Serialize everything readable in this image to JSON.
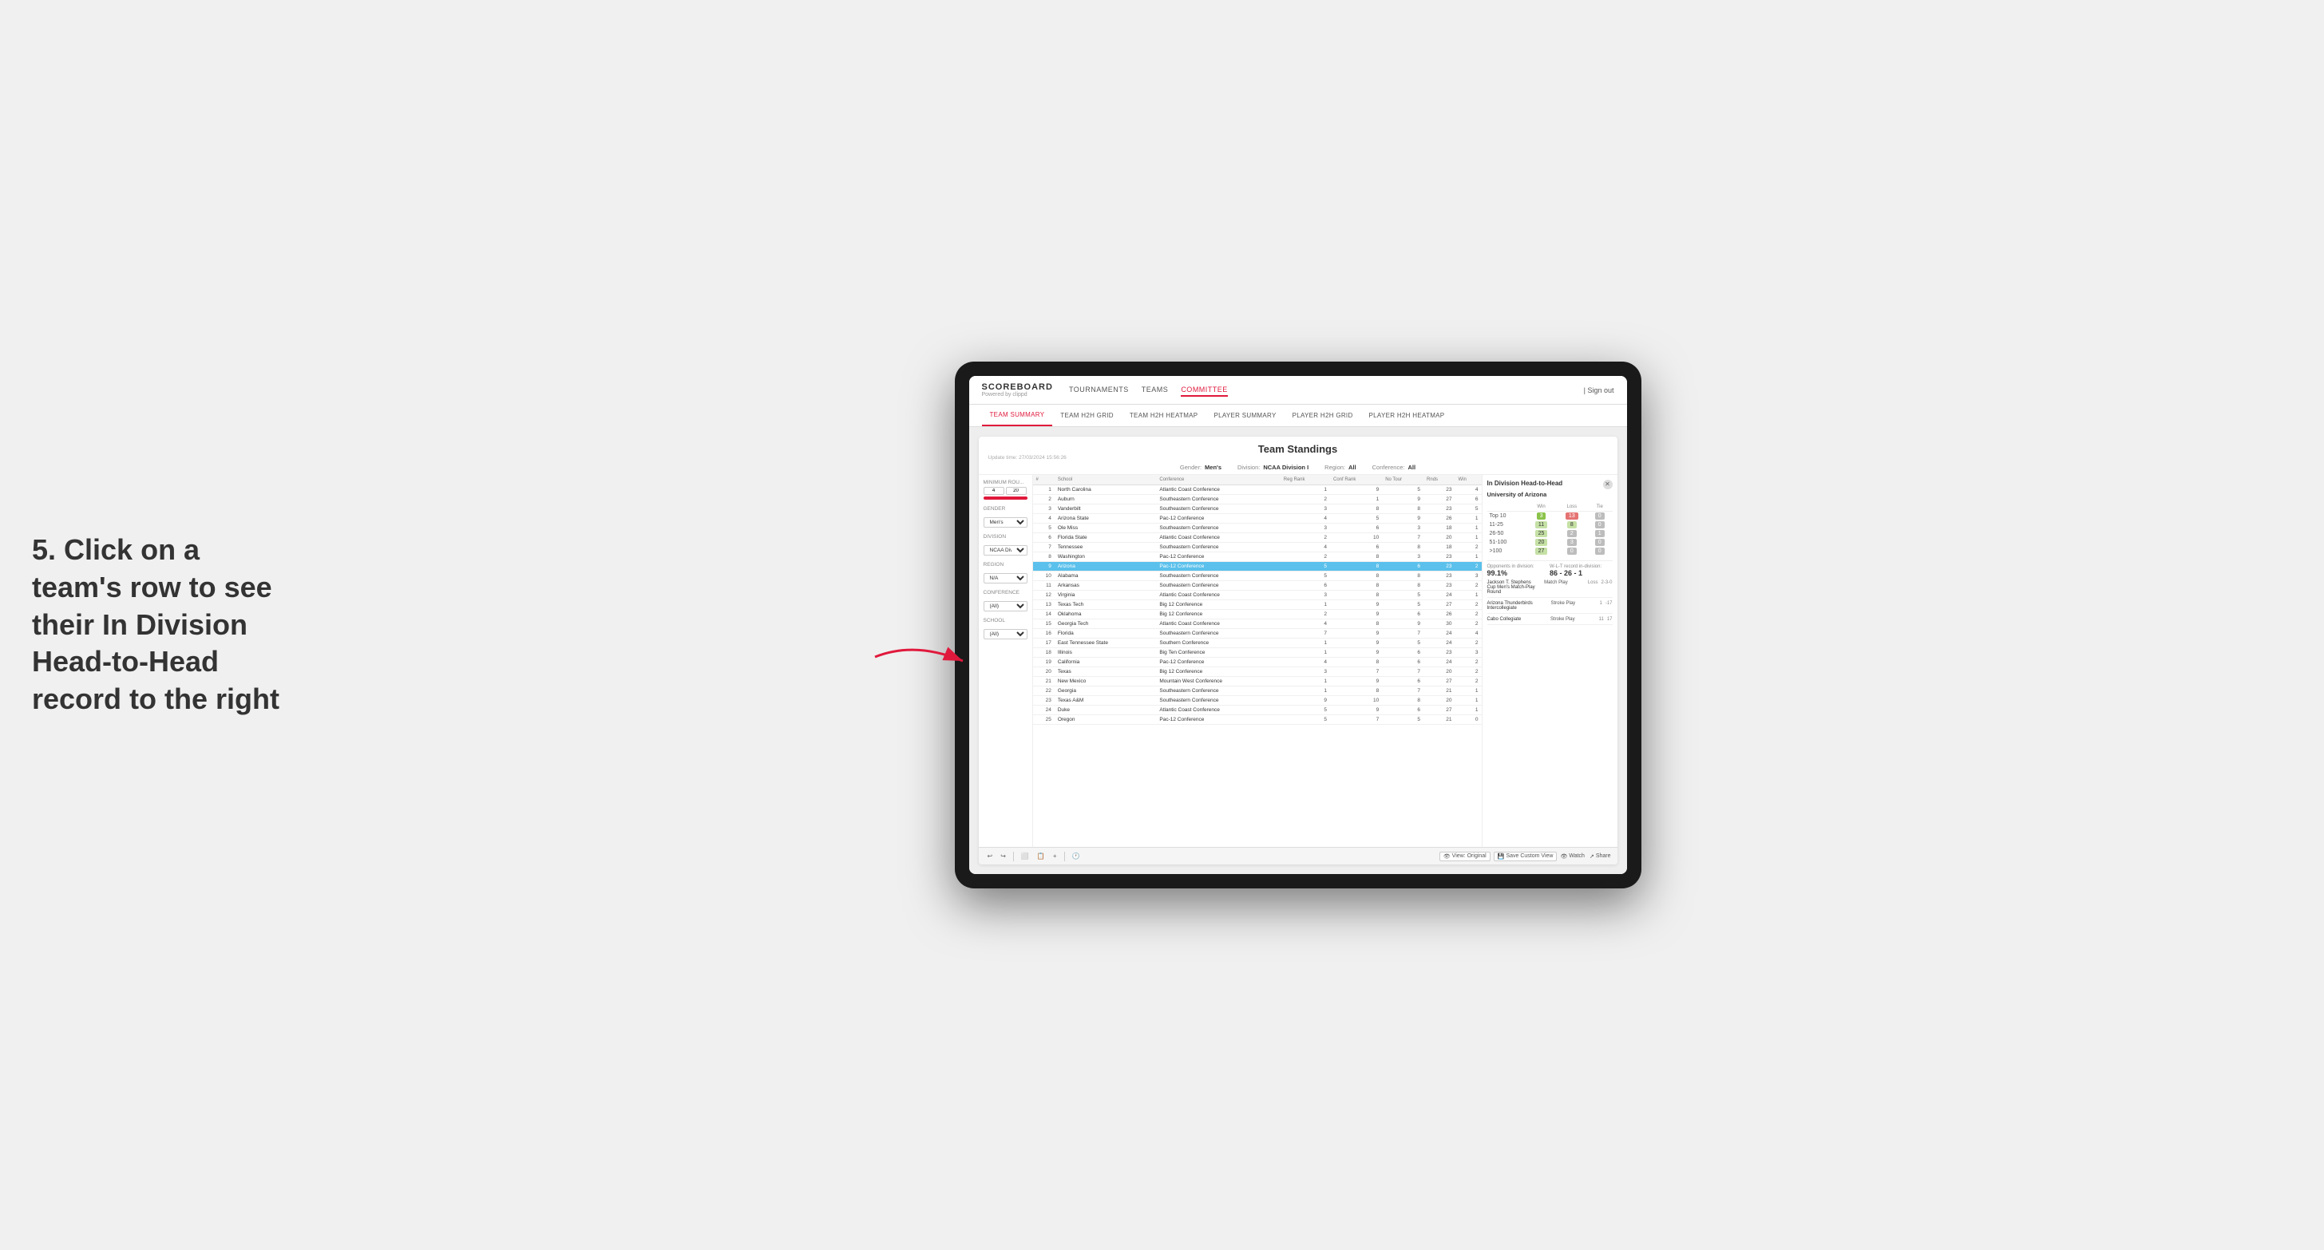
{
  "annotation": {
    "text": "5. Click on a team's row to see their In Division Head-to-Head record to the right"
  },
  "nav": {
    "logo": "SCOREBOARD",
    "logo_sub": "Powered by clippd",
    "links": [
      "TOURNAMENTS",
      "TEAMS",
      "COMMITTEE"
    ],
    "sign_out": "Sign out"
  },
  "sub_nav": {
    "links": [
      "TEAM SUMMARY",
      "TEAM H2H GRID",
      "TEAM H2H HEATMAP",
      "PLAYER SUMMARY",
      "PLAYER H2H GRID",
      "PLAYER H2H HEATMAP"
    ]
  },
  "dashboard": {
    "title": "Team Standings",
    "update_time": "Update time: 27/03/2024 15:56:26",
    "filters": {
      "gender_label": "Gender",
      "gender_value": "Men's",
      "division_label": "Division",
      "division_value": "NCAA Division I",
      "region_label": "Region",
      "region_value": "All",
      "conference_label": "Conference",
      "conference_value": "All"
    },
    "meta": {
      "gender_label": "Gender:",
      "gender_value": "Men's",
      "division_label": "Division:",
      "division_value": "NCAA Division I",
      "region_label": "Region:",
      "region_value": "All",
      "conference_label": "Conference:",
      "conference_value": "All"
    },
    "min_rounds_label": "Minimum Rou...",
    "min_rounds_min": "4",
    "min_rounds_max": "20",
    "school_label": "School",
    "school_value": "(All)",
    "table_headers": [
      "#",
      "School",
      "Conference",
      "Reg Rank",
      "Conf Rank",
      "No Tour",
      "Rnds",
      "Win"
    ],
    "rows": [
      {
        "rank": 1,
        "school": "North Carolina",
        "conference": "Atlantic Coast Conference",
        "reg_rank": 1,
        "conf_rank": 9,
        "no_tour": 5,
        "rnds": 23,
        "win": 4
      },
      {
        "rank": 2,
        "school": "Auburn",
        "conference": "Southeastern Conference",
        "reg_rank": 2,
        "conf_rank": 1,
        "no_tour": 9,
        "rnds": 27,
        "win": 6
      },
      {
        "rank": 3,
        "school": "Vanderbilt",
        "conference": "Southeastern Conference",
        "reg_rank": 3,
        "conf_rank": 8,
        "no_tour": 8,
        "rnds": 23,
        "win": 5
      },
      {
        "rank": 4,
        "school": "Arizona State",
        "conference": "Pac-12 Conference",
        "reg_rank": 4,
        "conf_rank": 5,
        "no_tour": 9,
        "rnds": 26,
        "win": 1
      },
      {
        "rank": 5,
        "school": "Ole Miss",
        "conference": "Southeastern Conference",
        "reg_rank": 3,
        "conf_rank": 6,
        "no_tour": 3,
        "rnds": 18,
        "win": 1
      },
      {
        "rank": 6,
        "school": "Florida State",
        "conference": "Atlantic Coast Conference",
        "reg_rank": 2,
        "conf_rank": 10,
        "no_tour": 7,
        "rnds": 20,
        "win": 1
      },
      {
        "rank": 7,
        "school": "Tennessee",
        "conference": "Southeastern Conference",
        "reg_rank": 4,
        "conf_rank": 6,
        "no_tour": 8,
        "rnds": 18,
        "win": 2
      },
      {
        "rank": 8,
        "school": "Washington",
        "conference": "Pac-12 Conference",
        "reg_rank": 2,
        "conf_rank": 8,
        "no_tour": 3,
        "rnds": 23,
        "win": 1
      },
      {
        "rank": 9,
        "school": "Arizona",
        "conference": "Pac-12 Conference",
        "reg_rank": 5,
        "conf_rank": 8,
        "no_tour": 6,
        "rnds": 23,
        "win": 2,
        "highlighted": true
      },
      {
        "rank": 10,
        "school": "Alabama",
        "conference": "Southeastern Conference",
        "reg_rank": 5,
        "conf_rank": 8,
        "no_tour": 8,
        "rnds": 23,
        "win": 3
      },
      {
        "rank": 11,
        "school": "Arkansas",
        "conference": "Southeastern Conference",
        "reg_rank": 6,
        "conf_rank": 8,
        "no_tour": 8,
        "rnds": 23,
        "win": 2
      },
      {
        "rank": 12,
        "school": "Virginia",
        "conference": "Atlantic Coast Conference",
        "reg_rank": 3,
        "conf_rank": 8,
        "no_tour": 5,
        "rnds": 24,
        "win": 1
      },
      {
        "rank": 13,
        "school": "Texas Tech",
        "conference": "Big 12 Conference",
        "reg_rank": 1,
        "conf_rank": 9,
        "no_tour": 5,
        "rnds": 27,
        "win": 2
      },
      {
        "rank": 14,
        "school": "Oklahoma",
        "conference": "Big 12 Conference",
        "reg_rank": 2,
        "conf_rank": 9,
        "no_tour": 6,
        "rnds": 26,
        "win": 2
      },
      {
        "rank": 15,
        "school": "Georgia Tech",
        "conference": "Atlantic Coast Conference",
        "reg_rank": 4,
        "conf_rank": 8,
        "no_tour": 9,
        "rnds": 30,
        "win": 2
      },
      {
        "rank": 16,
        "school": "Florida",
        "conference": "Southeastern Conference",
        "reg_rank": 7,
        "conf_rank": 9,
        "no_tour": 7,
        "rnds": 24,
        "win": 4
      },
      {
        "rank": 17,
        "school": "East Tennessee State",
        "conference": "Southern Conference",
        "reg_rank": 1,
        "conf_rank": 9,
        "no_tour": 5,
        "rnds": 24,
        "win": 2
      },
      {
        "rank": 18,
        "school": "Illinois",
        "conference": "Big Ten Conference",
        "reg_rank": 1,
        "conf_rank": 9,
        "no_tour": 6,
        "rnds": 23,
        "win": 3
      },
      {
        "rank": 19,
        "school": "California",
        "conference": "Pac-12 Conference",
        "reg_rank": 4,
        "conf_rank": 8,
        "no_tour": 6,
        "rnds": 24,
        "win": 2
      },
      {
        "rank": 20,
        "school": "Texas",
        "conference": "Big 12 Conference",
        "reg_rank": 3,
        "conf_rank": 7,
        "no_tour": 7,
        "rnds": 20,
        "win": 2
      },
      {
        "rank": 21,
        "school": "New Mexico",
        "conference": "Mountain West Conference",
        "reg_rank": 1,
        "conf_rank": 9,
        "no_tour": 6,
        "rnds": 27,
        "win": 2
      },
      {
        "rank": 22,
        "school": "Georgia",
        "conference": "Southeastern Conference",
        "reg_rank": 1,
        "conf_rank": 8,
        "no_tour": 7,
        "rnds": 21,
        "win": 1
      },
      {
        "rank": 23,
        "school": "Texas A&M",
        "conference": "Southeastern Conference",
        "reg_rank": 9,
        "conf_rank": 10,
        "no_tour": 8,
        "rnds": 20,
        "win": 1
      },
      {
        "rank": 24,
        "school": "Duke",
        "conference": "Atlantic Coast Conference",
        "reg_rank": 5,
        "conf_rank": 9,
        "no_tour": 6,
        "rnds": 27,
        "win": 1
      },
      {
        "rank": 25,
        "school": "Oregon",
        "conference": "Pac-12 Conference",
        "reg_rank": 5,
        "conf_rank": 7,
        "no_tour": 5,
        "rnds": 21,
        "win": 0
      }
    ]
  },
  "h2h": {
    "title": "In Division Head-to-Head",
    "team": "University of Arizona",
    "col_headers": [
      "",
      "Win",
      "Loss",
      "Tie"
    ],
    "rows": [
      {
        "label": "Top 10",
        "win": 3,
        "loss": 13,
        "tie": 0,
        "win_color": "green",
        "loss_color": "red"
      },
      {
        "label": "11-25",
        "win": 11,
        "loss": 8,
        "tie": 0,
        "win_color": "lime",
        "loss_color": "lime"
      },
      {
        "label": "26-50",
        "win": 25,
        "loss": 2,
        "tie": 1,
        "win_color": "lime",
        "loss_color": "gray"
      },
      {
        "label": "51-100",
        "win": 20,
        "loss": 3,
        "tie": 0,
        "win_color": "lime",
        "loss_color": "gray"
      },
      {
        "label": ">100",
        "win": 27,
        "loss": 0,
        "tie": 0,
        "win_color": "lime",
        "loss_color": "gray"
      }
    ],
    "opponents_label": "Opponents in division:",
    "opponents_value": "99.1%",
    "record_label": "W-L-T record in-division:",
    "record_value": "86 - 26 - 1",
    "tournaments": [
      {
        "name": "Jackson T. Stephens Cup Men's Match-Play Round",
        "event_type": "Match Play",
        "result": "Loss",
        "pos": "",
        "score": "2-3-0"
      },
      {
        "name": "Arizona Thunderbirds Intercollegiate",
        "event_type": "Stroke Play",
        "result": "",
        "pos": 1,
        "score": "-17"
      },
      {
        "name": "Cabo Collegiate",
        "event_type": "Stroke Play",
        "result": "",
        "pos": 11,
        "score": "17"
      }
    ]
  },
  "toolbar": {
    "view_original": "View: Original",
    "save_custom": "Save Custom View",
    "watch": "Watch",
    "share": "Share"
  }
}
